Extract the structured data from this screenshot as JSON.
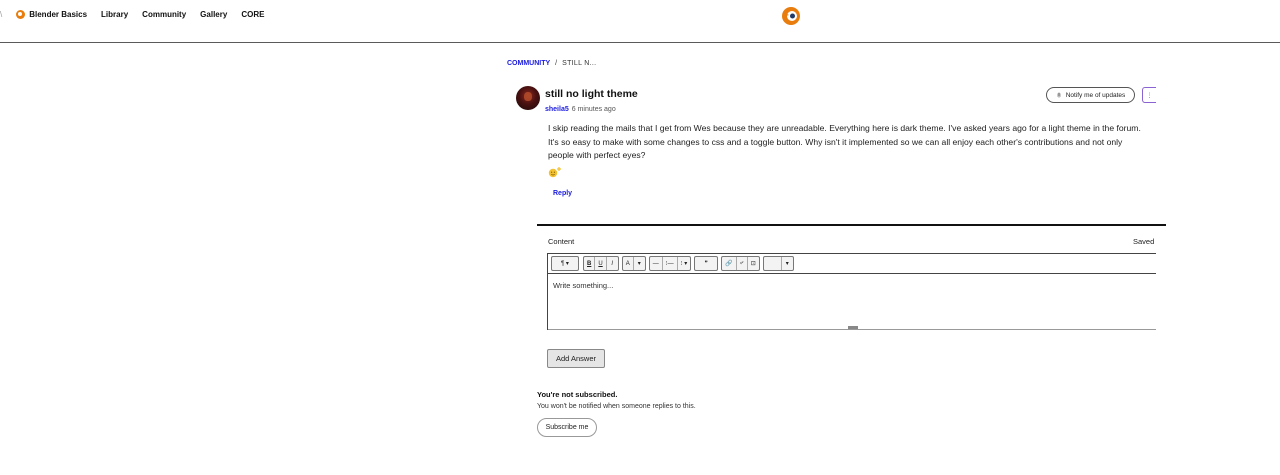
{
  "nav": {
    "edge_mark": "\\",
    "brand_label": "Blender Basics",
    "links": [
      "Library",
      "Community",
      "Gallery",
      "CORE"
    ]
  },
  "breadcrumb": {
    "section": "COMMUNITY",
    "separator": "/",
    "current": "STILL N..."
  },
  "post": {
    "title": "still no light theme",
    "author": "sheila5",
    "time": "6 minutes ago",
    "body": "I skip reading the mails that I get from Wes because they are unreadable. Everything here is dark theme. I've asked years ago for a light theme in the forum. It's so easy to make with some changes to css and a toggle button. Why isn't it implemented so we can all enjoy each other's contributions and not only people with perfect eyes?",
    "reply_label": "Reply",
    "notify_label": "Notify me of updates"
  },
  "editor": {
    "content_label": "Content",
    "status": "Saved",
    "placeholder": "Write something...",
    "toolbar": {
      "group1": [
        "¶ ▾"
      ],
      "group2": [
        "B",
        "U",
        "I"
      ],
      "group3": [
        "A",
        "▾"
      ],
      "group4": [
        "—",
        "⁝—",
        "⁝ ▾"
      ],
      "group5": [
        "❞"
      ],
      "group6": [
        "🔗",
        "⤶",
        "⊡"
      ],
      "group7": [
        "",
        "▾"
      ]
    },
    "submit_label": "Add Answer"
  },
  "subscription": {
    "title": "You're not subscribed.",
    "description": "You won't be notified when someone replies to this.",
    "button_label": "Subscribe me"
  },
  "colors": {
    "link": "#1a1adf",
    "brand_orange": "#e87d0d",
    "accent_purple": "#8a63d2"
  }
}
